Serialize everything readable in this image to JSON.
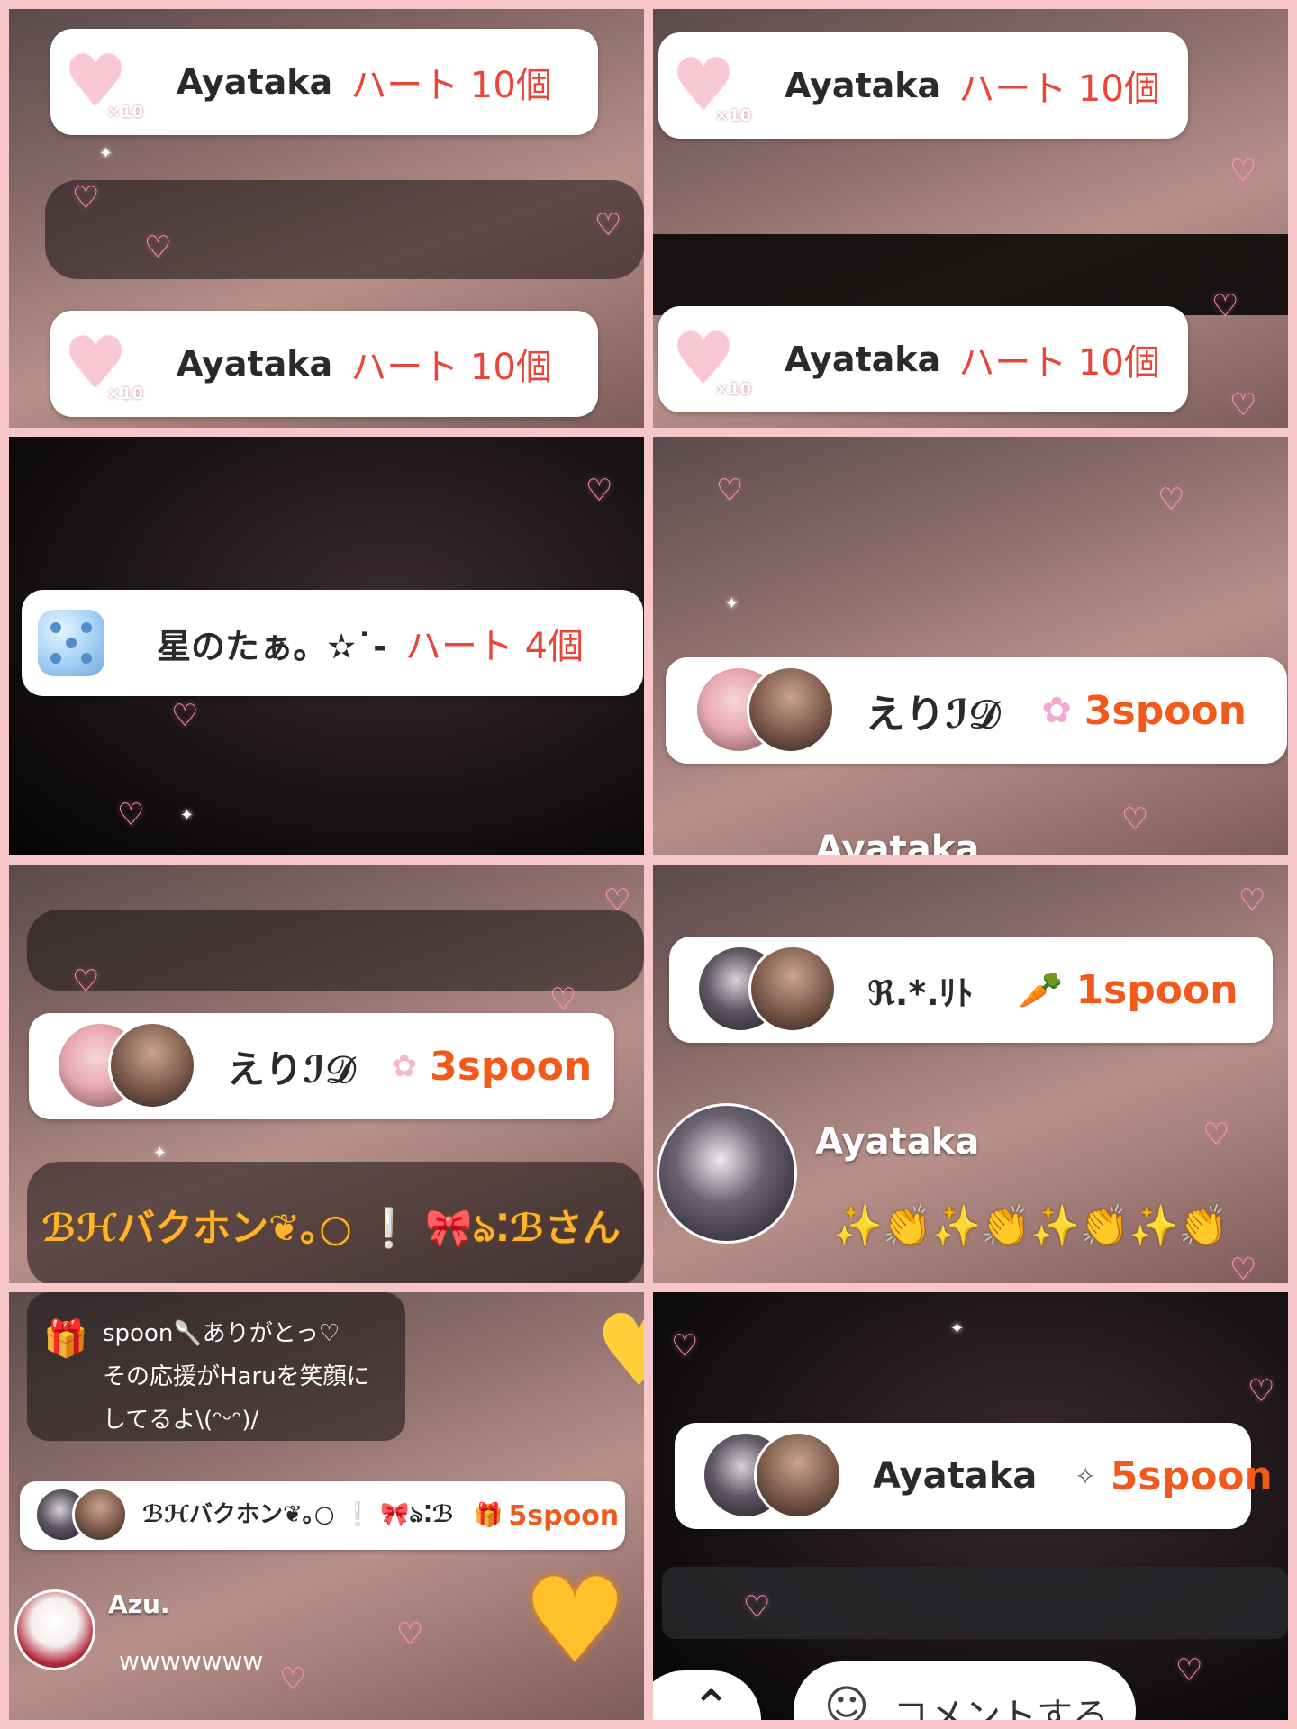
{
  "tiles": {
    "t1": {
      "rows": [
        {
          "name": "Ayataka",
          "gift": "ハート 10個",
          "badge": "×10"
        },
        {
          "name": "Ayataka",
          "gift": "ハート 10個",
          "badge": "×10"
        }
      ]
    },
    "t2": {
      "rows": [
        {
          "name": "Ayataka",
          "gift": "ハート 10個",
          "badge": "×10"
        },
        {
          "name": "Ayataka",
          "gift": "ハート 10個",
          "badge": "×10"
        }
      ]
    },
    "t3": {
      "name": "星のたぁ。✫˙-",
      "gift": "ハート 4個"
    },
    "t4": {
      "name": "えりℐ𝒟",
      "spoon": "3spoon",
      "cut_name": "Ayataka"
    },
    "t5": {
      "name": "えりℐ𝒟",
      "spoon": "3spoon",
      "message": "ℬℋバクホン❦｡○ ❕ 🎀ঌ⁚ℬさん"
    },
    "t6": {
      "name": "ℜ.*.ﾘﾄ",
      "spoon": "1spoon",
      "user": "Ayataka",
      "emoji_line": "✨👏✨👏✨👏✨👏"
    },
    "t7": {
      "thanks_lines": [
        "spoon🥄ありがとっ♡",
        "その応援がHaruを笑顔に",
        "してるよ\\(ᵔᵕᵔ)/"
      ],
      "name": "ℬℋバクホン❦｡○ ❕ 🎀ঌ⁚ℬ",
      "spoon": "5spoon",
      "user": "Azu.",
      "comment": "wwwwwww"
    },
    "t8": {
      "name": "Ayataka",
      "spoon": "5spoon",
      "comment_button": "コメントする"
    }
  }
}
